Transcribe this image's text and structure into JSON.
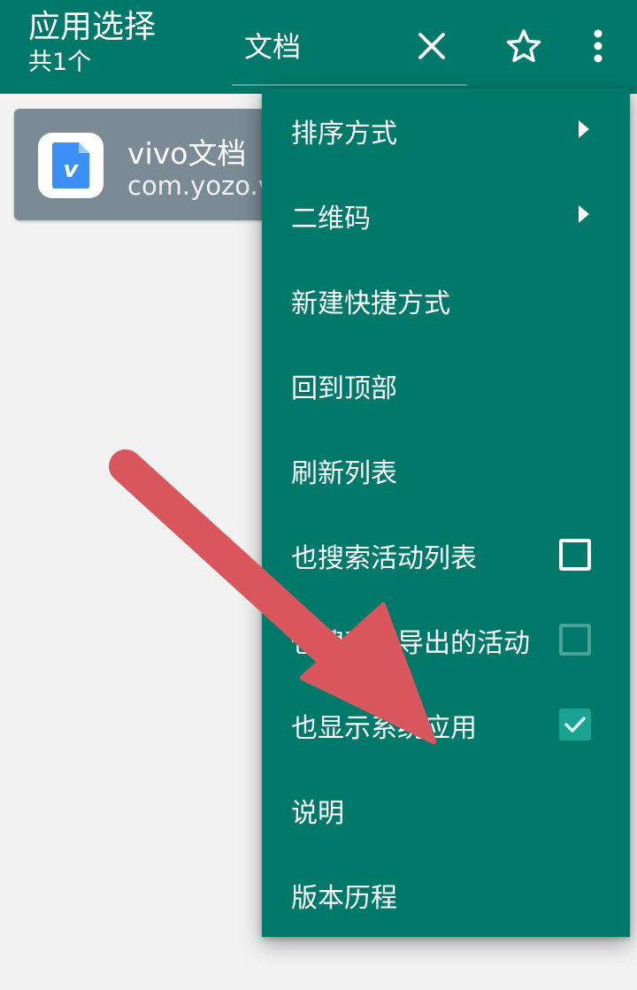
{
  "appbar": {
    "title": "应用选择",
    "subtitle": "共1个",
    "search_value": "文档",
    "icons": [
      "close-icon",
      "star-outline-icon",
      "more-vert-icon"
    ]
  },
  "app_card": {
    "name": "vivo文档",
    "package": "com.yozo.v",
    "icon": "vivo-docs-icon",
    "icon_letter": "v",
    "icon_color": "#3b8ff5"
  },
  "menu": {
    "items": [
      {
        "label": "排序方式",
        "type": "submenu"
      },
      {
        "label": "二维码",
        "type": "submenu"
      },
      {
        "label": "新建快捷方式",
        "type": "action"
      },
      {
        "label": "回到顶部",
        "type": "action"
      },
      {
        "label": "刷新列表",
        "type": "action"
      },
      {
        "label": "也搜索活动列表",
        "type": "checkbox",
        "checked": false,
        "enabled": true
      },
      {
        "label": "也搜索未导出的活动",
        "type": "checkbox",
        "checked": false,
        "enabled": false
      },
      {
        "label": "也显示系统应用",
        "type": "checkbox",
        "checked": true,
        "enabled": true
      },
      {
        "label": "说明",
        "type": "action"
      },
      {
        "label": "版本历程",
        "type": "action"
      }
    ]
  },
  "colors": {
    "primary": "#00796b",
    "checkbox_checked": "#1aa392",
    "card": "#7b8b95",
    "annotation_arrow": "#d9575c",
    "background": "#f2f2f2"
  }
}
